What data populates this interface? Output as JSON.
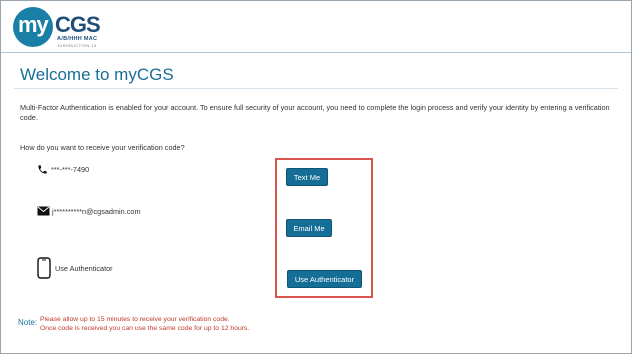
{
  "header": {
    "logo": {
      "my": "my",
      "cgs": "CGS",
      "subtitle": "A/B/HHH MAC",
      "subtitle2": "JURISDICTION 15"
    },
    "colors": {
      "brand": "#1a7fa6",
      "brand_dark": "#1e4f7a"
    }
  },
  "main": {
    "title": "Welcome to myCGS",
    "intro": "Multi-Factor Authentication is enabled for your account. To ensure full security of your account, you need to complete the login process and verify your identity by entering a verification code.",
    "question": "How do you want to receive your verification code?",
    "options": [
      {
        "icon": "phone-icon",
        "label": "***-***-7490",
        "button": "Text Me"
      },
      {
        "icon": "envelope-icon",
        "label": "j**********n@cgsadmin.com",
        "button": "Email Me"
      },
      {
        "icon": "smartphone-icon",
        "label": "Use Authenticator",
        "button": "Use Authenticator"
      }
    ],
    "highlight_color": "#d9534f",
    "button_color": "#156e96"
  },
  "note": {
    "label": "Note:",
    "line1": "Please allow up to 15 minutes to receive your verification code.",
    "line2": "Once code is received you can use the same code for up to 12 hours."
  }
}
